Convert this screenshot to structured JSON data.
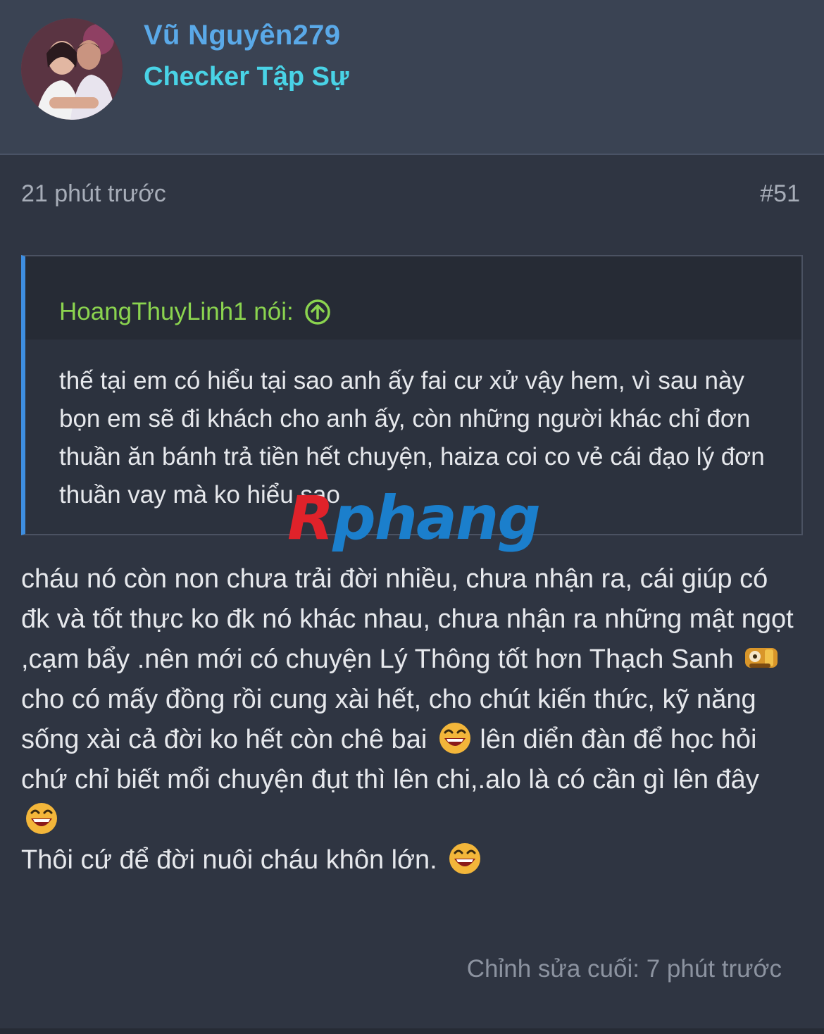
{
  "header": {
    "username": "Vũ Nguyên279",
    "user_title": "Checker Tập Sự"
  },
  "post": {
    "time": "21 phút trước",
    "number": "#51",
    "quote": {
      "author": "HoangThuyLinh1 nói:",
      "text": "thế tại em có hiểu tại sao anh ấy fai cư xử vậy hem, vì sau này bọn em sẽ đi khách cho anh ấy, còn những người khác chỉ đơn thuần ăn bánh trả tiền hết chuyện, haiza coi co vẻ cái đạo lý đơn thuần vay mà ko hiểu sao"
    },
    "body": {
      "para1": "cháu nó còn non chưa trải đời nhiều, chưa nhận ra, cái giúp có đk và tốt thực ko đk nó khác nhau, chưa nhận ra những mật ngọt ,cạm bẩy .nên mới có chuyện Lý Thông tốt hơn Thạch Sanh",
      "para2a": "cho có mấy đồng rồi cung xài hết, cho chút kiến thức, kỹ năng sống xài cả đời ko hết còn chê bai",
      "para2b": "lên diển đàn để học hỏi chứ chỉ biết mổi chuyện đụt thì lên chi,.alo là có cần gì lên đây",
      "para3": "Thôi cứ để đời nuôi cháu khôn lớn."
    },
    "edit_note": "Chỉnh sửa cuối: 7 phút trước"
  },
  "watermark": {
    "r": "R",
    "rest": "phang"
  },
  "colors": {
    "username": "#5aa9e8",
    "user_title": "#49d3e6",
    "quote_author": "#8bd44f",
    "quote_border": "#3e8ee0"
  },
  "icons": [
    "avatar",
    "quote-up-arrow-icon",
    "tired-emoji-icon",
    "laughing-emoji-icon"
  ]
}
